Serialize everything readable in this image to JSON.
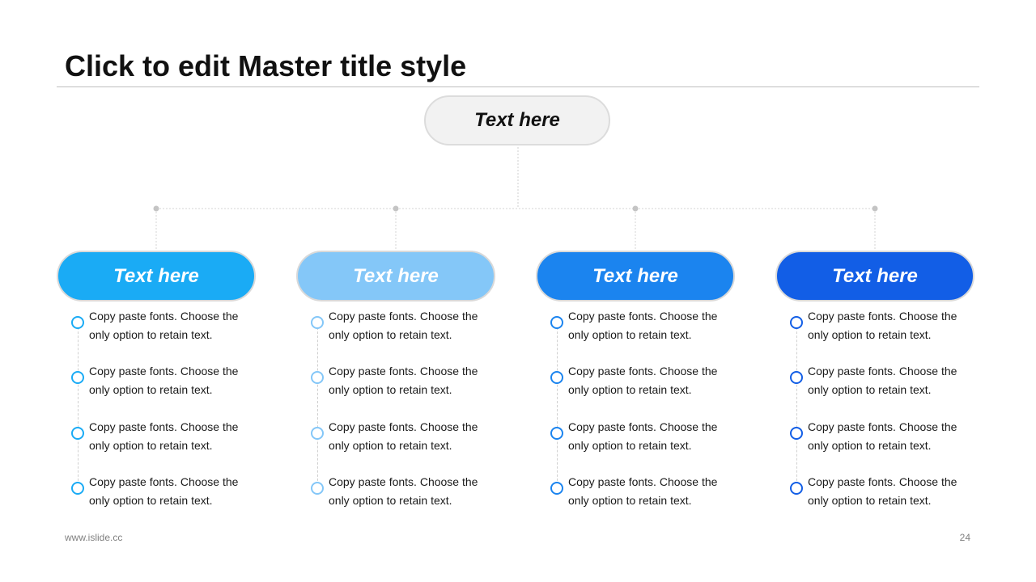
{
  "title": "Click to edit Master title style",
  "root": {
    "label": "Text here"
  },
  "branches": [
    {
      "label": "Text here",
      "color": "#1aabf5",
      "items": [
        "Copy paste fonts. Choose the only option to retain text.",
        "Copy paste fonts. Choose the only option to retain text.",
        "Copy paste fonts. Choose the only option to retain text.",
        "Copy paste fonts. Choose the only option to retain text."
      ]
    },
    {
      "label": "Text here",
      "color": "#84c7f8",
      "items": [
        "Copy paste fonts. Choose the only option to retain text.",
        "Copy paste fonts. Choose the only option to retain text.",
        "Copy paste fonts. Choose the only option to retain text.",
        "Copy paste fonts. Choose the only option to retain text."
      ]
    },
    {
      "label": "Text here",
      "color": "#1b84ef",
      "items": [
        "Copy paste fonts. Choose the only option to retain text.",
        "Copy paste fonts. Choose the only option to retain text.",
        "Copy paste fonts. Choose the only option to retain text.",
        "Copy paste fonts. Choose the only option to retain text."
      ]
    },
    {
      "label": "Text here",
      "color": "#125ee6",
      "items": [
        "Copy paste fonts. Choose the only option to retain text.",
        "Copy paste fonts. Choose the only option to retain text.",
        "Copy paste fonts. Choose the only option to retain text.",
        "Copy paste fonts. Choose the only option to retain text."
      ]
    }
  ],
  "footer": {
    "url": "www.islide.cc",
    "page_number": "24"
  }
}
